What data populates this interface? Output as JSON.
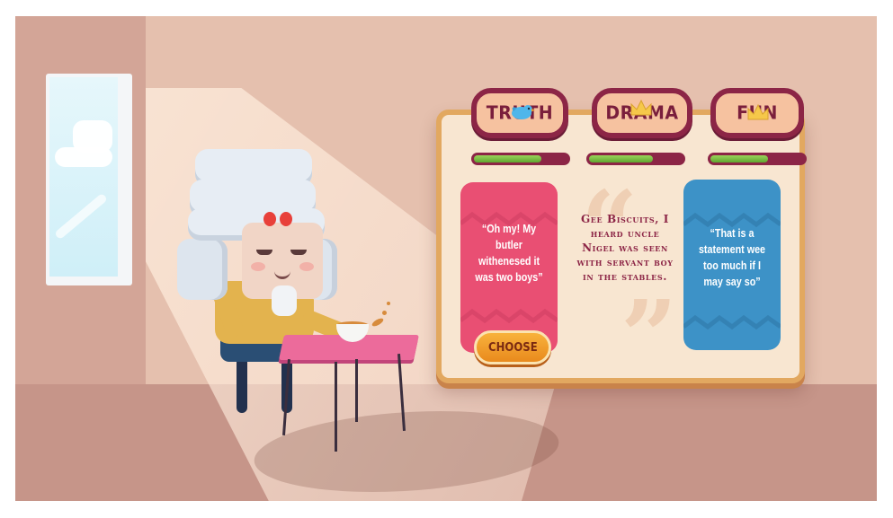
{
  "categories": [
    {
      "label": "TRUTH",
      "icon": "bird-icon",
      "progress": 0.72
    },
    {
      "label": "DRAMA",
      "icon": "crown-icon",
      "progress": 0.68
    },
    {
      "label": "FUN",
      "icon": "crown-icon",
      "progress": 0.62
    }
  ],
  "options": {
    "truth": {
      "text": "“Oh my! My butler withenesed it was two boys”",
      "color": "#e94f73"
    },
    "drama": {
      "text": "Gee Biscuits, I heard uncle Nigel was seen with servant boy in the stables.",
      "color": "#8c2546"
    },
    "fun": {
      "text": "“That is a statement wee too much if I may say so”",
      "color": "#3d92c7"
    }
  },
  "choose_label": "CHOOSE",
  "colors": {
    "panel": "#f8e6d1",
    "tab_border": "#8c2546",
    "progress_fill": "#7cc04a",
    "button": "#f0a02c"
  }
}
